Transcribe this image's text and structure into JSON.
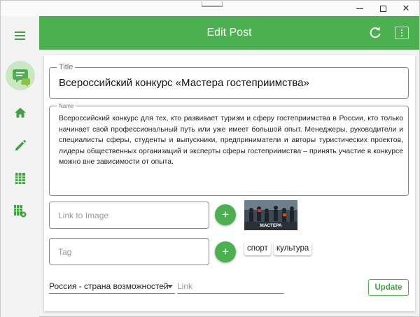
{
  "window": {
    "minimize_icon": "minimize-icon",
    "maximize_icon": "maximize-icon",
    "close_glyph": "✕"
  },
  "sidebar": {
    "items": [
      {
        "icon": "menu-icon"
      },
      {
        "icon": "chat-logo-icon"
      },
      {
        "icon": "home-icon"
      },
      {
        "icon": "pencil-icon"
      },
      {
        "icon": "grid-table-icon"
      },
      {
        "icon": "table-settings-icon"
      }
    ],
    "accent_color": "#43a047"
  },
  "header": {
    "title": "Edit Post",
    "refresh_icon": "refresh-icon",
    "menu_icon": "more-vert-icon",
    "background": "#4caf50"
  },
  "form": {
    "title_label": "Title",
    "title_value": "Всероссийский конкурс «Мастера гостеприимства»",
    "name_label": "Name",
    "name_value": "Всероссийский конкурс для тех, кто развивает туризм и сферу гостеприимства в России, кто только начинает свой профессиональный путь или уже имеет большой опыт. Менеджеры, руководители и специалисты сферы, студенты и выпускники, предприниматели и авторы туристических проектов, лидеры общественных организаций и эксперты сферы гостеприимства – принять участие в конкурсе можно вне зависимости от опыта.",
    "image_placeholder": "Link to Image",
    "add_image_label": "+",
    "image_caption": "МАСТЕРА",
    "tag_placeholder": "Tag",
    "add_tag_label": "+",
    "tags": [
      "спорт",
      "культура"
    ],
    "category_selected": "Россия - страна возможностей",
    "link_placeholder": "Link",
    "update_label": "Update"
  }
}
